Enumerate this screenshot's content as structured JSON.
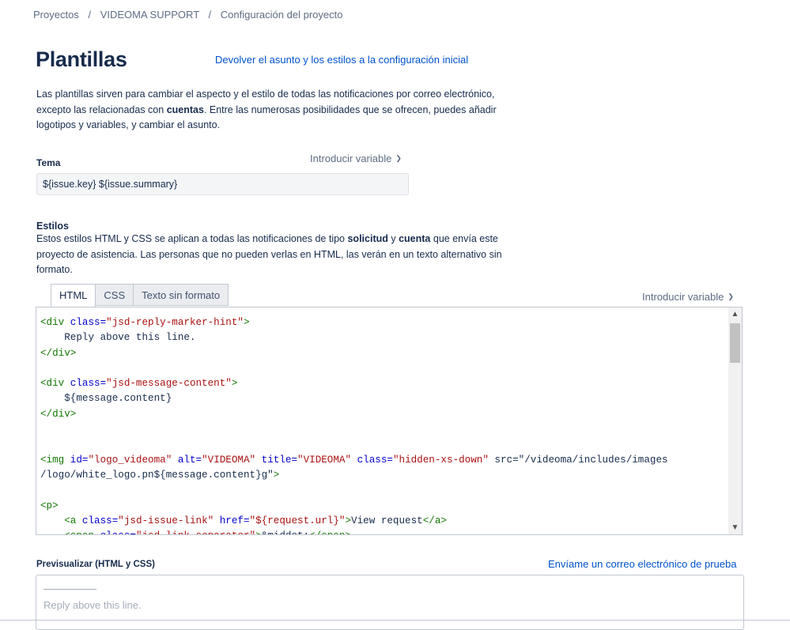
{
  "breadcrumb": {
    "items": [
      "Proyectos",
      "VIDEOMA SUPPORT",
      "Configuración del proyecto"
    ],
    "separator": "/"
  },
  "page": {
    "title": "Plantillas",
    "reset_link": "Devolver el asunto y los estilos a la configuración inicial",
    "intro": {
      "part1": "Las plantillas sirven para cambiar el aspecto y el estilo de todas las notificaciones por correo electrónico, excepto las relacionadas con ",
      "bold1": "cuentas",
      "part2": ". Entre las numerosas posibilidades que se ofrecen, puedes añadir logotipos y variables, y cambiar el asunto."
    }
  },
  "subject": {
    "label": "Tema",
    "insert_variable": "Introducir variable",
    "value": "${issue.key} ${issue.summary}"
  },
  "styles": {
    "label": "Estilos",
    "desc": {
      "part1": "Estos estilos HTML y CSS se aplican a todas las notificaciones de tipo ",
      "bold1": "solicitud",
      "part2": " y ",
      "bold2": "cuenta",
      "part3": " que envía este proyecto de asistencia. Las personas que no pueden verlas en HTML, las verán en un texto alternativo sin formato."
    },
    "tabs": [
      "HTML",
      "CSS",
      "Texto sin formato"
    ],
    "active_tab": "HTML",
    "insert_variable": "Introducir variable",
    "code_lines": [
      "<div class=\"jsd-reply-marker-hint\">",
      "    Reply above this line.",
      "</div>",
      "",
      "<div class=\"jsd-message-content\">",
      "    ${message.content}",
      "</div>",
      "",
      "",
      "<img id=\"logo_videoma\" alt=\"VIDEOMA\" title=\"VIDEOMA\" class=\"hidden-xs-down\" src=\"/videoma/includes/images",
      "/logo/white_logo.pn${message.content}g\">",
      "",
      "<p>",
      "    <a class=\"jsd-issue-link\" href=\"${request.url}\">View request</a>",
      "    <span class=\"jsd-link-separator\">&middot;</span>"
    ]
  },
  "preview": {
    "label": "Previsualizar (HTML y CSS)",
    "test_email_link": "Envíame un correo electrónico de prueba",
    "reply_hint": "Reply above this line."
  },
  "colors": {
    "link": "#0052cc",
    "text": "#172b4d",
    "muted": "#5e6c84",
    "code_tag": "#117700",
    "code_attr": "#0000cc",
    "code_string": "#aa1111"
  },
  "icons": {
    "dropdown": "chevron-down-icon",
    "scroll_up": "scroll-up-arrow-icon",
    "scroll_down": "scroll-down-arrow-icon"
  }
}
